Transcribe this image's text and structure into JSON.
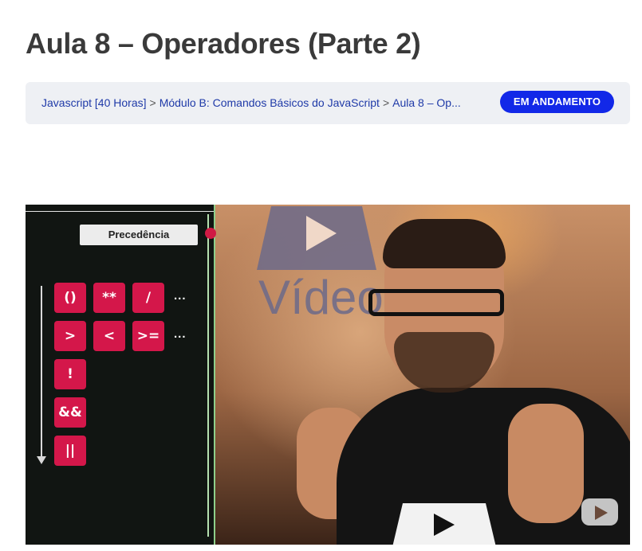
{
  "page": {
    "title": "Aula 8 – Operadores (Parte 2)"
  },
  "breadcrumb": {
    "items": [
      "Javascript [40 Horas]",
      "Módulo B: Comandos Básicos do JavaScript",
      "Aula 8 – Op..."
    ],
    "separator": ">"
  },
  "status_badge": {
    "label": "EM ANDAMENTO",
    "color": "#1228e8"
  },
  "video": {
    "panel_title": "Precedência",
    "operators_row1": [
      "()",
      "**",
      "/"
    ],
    "operators_row2": [
      ">",
      "<",
      ">="
    ],
    "operators_single": [
      "!",
      "&&",
      "||"
    ],
    "ellipsis": "...",
    "wall_text": "Vídeo",
    "accent_color": "#d4174a"
  }
}
